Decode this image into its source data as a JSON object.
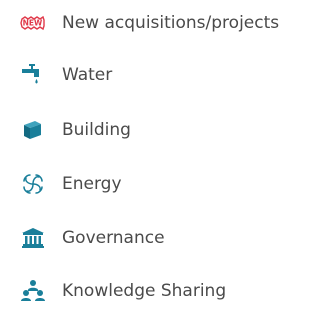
{
  "menu": {
    "items": [
      {
        "label": "New acquisitions/projects",
        "icon": "new-badge-icon",
        "color": "#e0394a"
      },
      {
        "label": "Water",
        "icon": "water-tap-icon",
        "color": "#1a7f9a"
      },
      {
        "label": "Building",
        "icon": "building-box-icon",
        "color": "#1a7f9a"
      },
      {
        "label": "Energy",
        "icon": "energy-swirl-icon",
        "color": "#1a7f9a"
      },
      {
        "label": "Governance",
        "icon": "governance-building-icon",
        "color": "#1a7f9a"
      },
      {
        "label": "Knowledge Sharing",
        "icon": "knowledge-sharing-icon",
        "color": "#1a7f9a"
      }
    ]
  }
}
